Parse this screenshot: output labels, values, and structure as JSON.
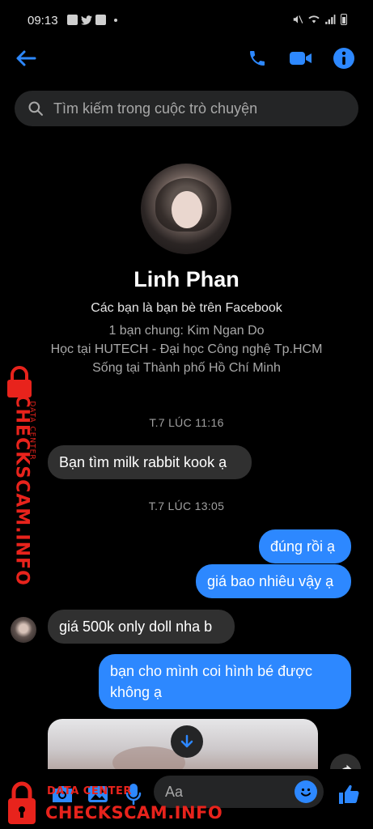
{
  "status_bar": {
    "time": "09:13",
    "icons": [
      "photo-icon",
      "twitter-icon",
      "photo-icon",
      "dot-icon"
    ],
    "right_icons": [
      "mute-icon",
      "wifi-icon",
      "signal-icon",
      "battery-icon"
    ]
  },
  "nav": {
    "back_icon": "back-arrow-icon",
    "call_icon": "phone-icon",
    "video_icon": "video-camera-icon",
    "info_icon": "info-icon"
  },
  "search": {
    "placeholder": "Tìm kiếm trong cuộc trò chuyện"
  },
  "profile": {
    "name": "Linh Phan",
    "friend_status": "Các bạn là bạn bè trên Facebook",
    "mutual": "1 bạn chung: Kim Ngan Do",
    "school": "Học tại HUTECH - Đại học Công nghệ Tp.HCM",
    "location": "Sống tại Thành phố Hồ Chí Minh"
  },
  "conversation": {
    "timestamp_1": "T.7 LÚC 11:16",
    "timestamp_2": "T.7 LÚC 13:05",
    "messages": [
      {
        "side": "in",
        "text": "Bạn tìm milk rabbit kook ạ"
      },
      {
        "side": "out",
        "text": "đúng rồi ạ"
      },
      {
        "side": "out",
        "text": "giá bao nhiêu vậy ạ"
      },
      {
        "side": "in",
        "text": "giá 500k only doll nha b"
      },
      {
        "side": "out",
        "text": "bạn cho mình coi hình bé được không ạ"
      }
    ]
  },
  "composer": {
    "placeholder": "Aa",
    "icons": [
      "camera-icon",
      "gallery-icon",
      "microphone-icon",
      "emoji-icon",
      "thumbs-up-icon"
    ]
  },
  "watermark": {
    "side_text": "CHECKSCAM.INFO",
    "side_small": "DATA CENTER",
    "bottom_text": "CHECKSCAM.INFO",
    "bottom_small": "DATA CENTER"
  },
  "colors": {
    "accent": "#2d88ff",
    "incoming_bubble": "#303030",
    "watermark": "#e8231c"
  }
}
